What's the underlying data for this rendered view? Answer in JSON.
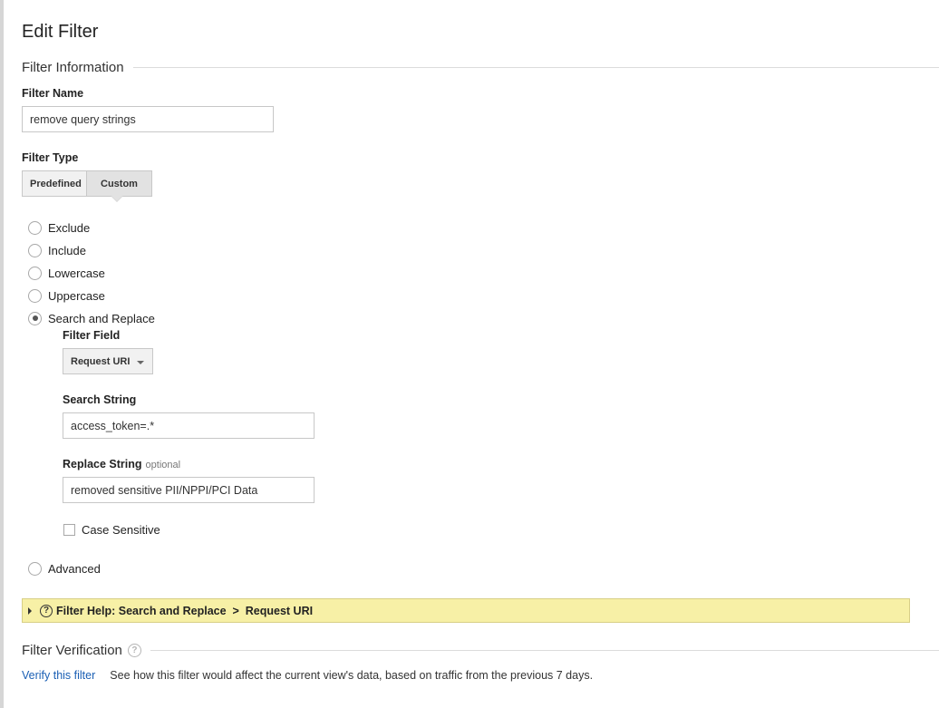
{
  "page": {
    "title": "Edit Filter"
  },
  "filter_information": {
    "section_title": "Filter Information",
    "filter_name_label": "Filter Name",
    "filter_name_value": "remove query strings",
    "filter_type_label": "Filter Type",
    "type_tabs": [
      {
        "label": "Predefined",
        "selected": false
      },
      {
        "label": "Custom",
        "selected": true
      }
    ],
    "options": [
      {
        "label": "Exclude",
        "checked": false
      },
      {
        "label": "Include",
        "checked": false
      },
      {
        "label": "Lowercase",
        "checked": false
      },
      {
        "label": "Uppercase",
        "checked": false
      },
      {
        "label": "Search and Replace",
        "checked": true
      },
      {
        "label": "Advanced",
        "checked": false
      }
    ],
    "search_replace": {
      "filter_field_label": "Filter Field",
      "filter_field_value": "Request URI",
      "search_string_label": "Search String",
      "search_string_value": "access_token=.*",
      "replace_string_label": "Replace String",
      "replace_string_optional": "optional",
      "replace_string_value": "removed sensitive PII/NPPI/PCI Data",
      "case_sensitive_label": "Case Sensitive",
      "case_sensitive_checked": false
    },
    "help": {
      "icon": "question-circle-icon",
      "text": "Filter Help: Search and Replace  >  Request URI"
    }
  },
  "filter_verification": {
    "section_title": "Filter Verification",
    "help_icon": "question-circle-icon",
    "verify_link": "Verify this filter",
    "description": "See how this filter would affect the current view's data, based on traffic from the previous 7 days."
  },
  "colors": {
    "link": "#1a5fb4",
    "help_bar_bg": "#f7f0a6",
    "selected_tab_bg": "#e2e2e2"
  }
}
